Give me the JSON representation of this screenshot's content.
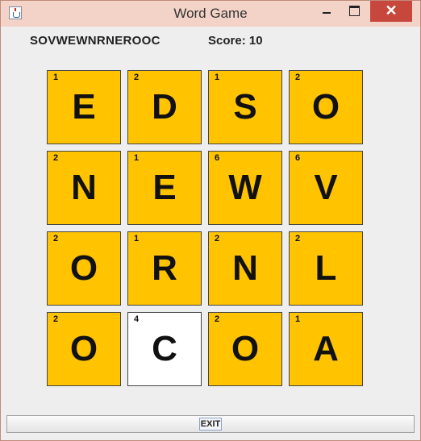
{
  "window": {
    "title": "Word Game"
  },
  "header": {
    "current_word": "SOVWEWNRNEROOC",
    "score_label": "Score: 10"
  },
  "tiles": [
    {
      "letter": "E",
      "points": "1",
      "selected": false
    },
    {
      "letter": "D",
      "points": "2",
      "selected": false
    },
    {
      "letter": "S",
      "points": "1",
      "selected": false
    },
    {
      "letter": "O",
      "points": "2",
      "selected": false
    },
    {
      "letter": "N",
      "points": "2",
      "selected": false
    },
    {
      "letter": "E",
      "points": "1",
      "selected": false
    },
    {
      "letter": "W",
      "points": "6",
      "selected": false
    },
    {
      "letter": "V",
      "points": "6",
      "selected": false
    },
    {
      "letter": "O",
      "points": "2",
      "selected": false
    },
    {
      "letter": "R",
      "points": "1",
      "selected": false
    },
    {
      "letter": "N",
      "points": "2",
      "selected": false
    },
    {
      "letter": "L",
      "points": "2",
      "selected": false
    },
    {
      "letter": "O",
      "points": "2",
      "selected": false
    },
    {
      "letter": "C",
      "points": "4",
      "selected": true
    },
    {
      "letter": "O",
      "points": "2",
      "selected": false
    },
    {
      "letter": "A",
      "points": "1",
      "selected": false
    }
  ],
  "footer": {
    "exit_label": "EXIT"
  },
  "colors": {
    "tile": "#ffc300",
    "tile_selected": "#ffffff",
    "close": "#c7473c"
  },
  "icons": [
    "java-cup-icon",
    "minimize-icon",
    "maximize-icon",
    "close-icon"
  ]
}
